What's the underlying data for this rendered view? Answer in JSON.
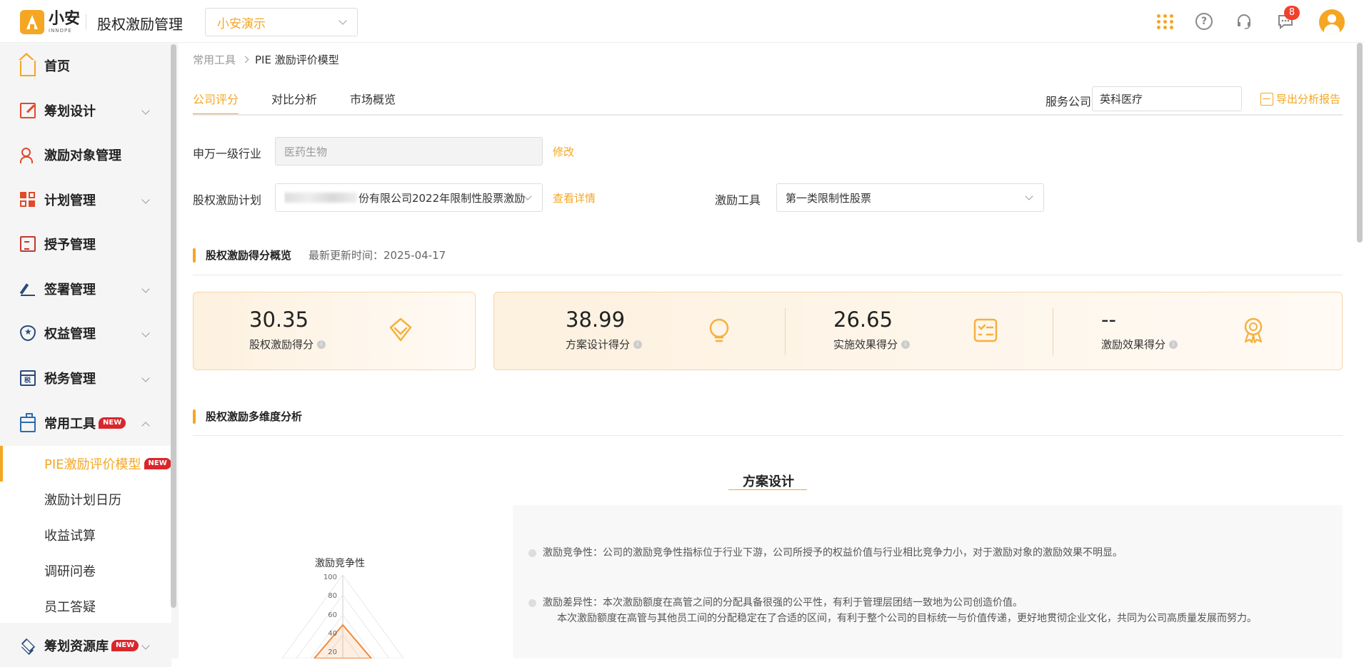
{
  "header": {
    "logo_cn": "小安",
    "logo_en": "INNOPE",
    "app_title": "股权激励管理",
    "company_select": "小安演示",
    "notification_count": "8"
  },
  "sidebar": {
    "items": [
      {
        "label": "首页"
      },
      {
        "label": "筹划设计"
      },
      {
        "label": "激励对象管理"
      },
      {
        "label": "计划管理"
      },
      {
        "label": "授予管理"
      },
      {
        "label": "签署管理"
      },
      {
        "label": "权益管理"
      },
      {
        "label": "税务管理"
      },
      {
        "label": "常用工具",
        "tag": "NEW"
      },
      {
        "label": "筹划资源库",
        "tag": "NEW"
      }
    ],
    "subitems": [
      {
        "label": "PIE激励评价模型",
        "tag": "NEW"
      },
      {
        "label": "激励计划日历"
      },
      {
        "label": "收益试算"
      },
      {
        "label": "调研问卷"
      },
      {
        "label": "员工答疑"
      }
    ]
  },
  "breadcrumb": {
    "parent": "常用工具",
    "current": "PIE 激励评价模型"
  },
  "tabs": [
    {
      "label": "公司评分"
    },
    {
      "label": "对比分析"
    },
    {
      "label": "市场概览"
    }
  ],
  "service": {
    "label": "服务公司",
    "value": "英科医疗",
    "export_label": "导出分析报告"
  },
  "form": {
    "industry_label": "申万一级行业",
    "industry_value": "医药生物",
    "industry_edit": "修改",
    "plan_label": "股权激励计划",
    "plan_value": "份有限公司2022年限制性股票激励",
    "plan_detail": "查看详情",
    "tool_label": "激励工具",
    "tool_value": "第一类限制性股票"
  },
  "overview": {
    "title": "股权激励得分概览",
    "updated": "最新更新时间：2025-04-17"
  },
  "scores": [
    {
      "value": "30.35",
      "label": "股权激励得分"
    },
    {
      "value": "38.99",
      "label": "方案设计得分"
    },
    {
      "value": "26.65",
      "label": "实施效果得分"
    },
    {
      "value": "--",
      "label": "激励效果得分"
    }
  ],
  "multi": {
    "title": "股权激励多维度分析"
  },
  "radar": {
    "title": "方案设计",
    "axis_label": "激励竞争性",
    "ticks": [
      "100",
      "80",
      "60",
      "40",
      "20"
    ]
  },
  "analysis": [
    {
      "text": "激励竞争性：公司的激励竞争性指标位于行业下游，公司所授予的权益价值与行业相比竞争力小，对于激励对象的激励效果不明显。"
    },
    {
      "text": "激励差异性：本次激励额度在高管之间的分配具备很强的公平性，有利于管理层团结一致地为公司创造价值。"
    },
    {
      "text": "本次激励额度在高管与其他员工间的分配稳定在了合适的区间，有利于整个公司的目标统一与价值传递，更好地贯彻企业文化，共同为公司高质量发展而努力。"
    }
  ],
  "colors": {
    "accent": "#f5a623",
    "badge": "#f0412b",
    "new_tag": "#d9262c"
  }
}
